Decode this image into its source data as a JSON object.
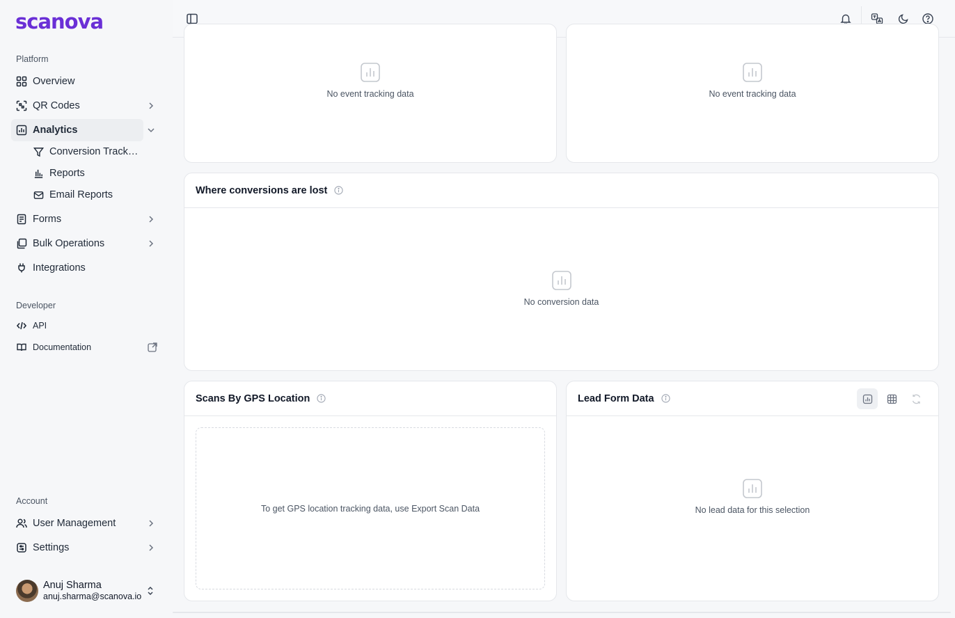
{
  "brand": {
    "logo_text": "scanova",
    "accent": "#6a2fd6"
  },
  "sidebar": {
    "sections": {
      "platform": "Platform",
      "developer": "Developer",
      "account": "Account"
    },
    "platform_items": [
      {
        "label": "Overview",
        "icon": "grid-icon"
      },
      {
        "label": "QR Codes",
        "icon": "qr-scan-icon"
      },
      {
        "label": "Analytics",
        "icon": "analytics-icon",
        "active": true,
        "expanded": true
      },
      {
        "label": "Forms",
        "icon": "form-icon"
      },
      {
        "label": "Bulk Operations",
        "icon": "bulk-icon"
      },
      {
        "label": "Integrations",
        "icon": "plug-icon"
      }
    ],
    "analytics_sub": [
      {
        "label": "Conversion Tracking",
        "icon": "funnel-icon"
      },
      {
        "label": "Reports",
        "icon": "bar-chart-icon"
      },
      {
        "label": "Email Reports",
        "icon": "mail-icon"
      }
    ],
    "developer_items": [
      {
        "label": "API",
        "icon": "code-icon"
      },
      {
        "label": "Documentation",
        "icon": "book-icon",
        "external": true
      }
    ],
    "account_items": [
      {
        "label": "User Management",
        "icon": "users-icon"
      },
      {
        "label": "Settings",
        "icon": "settings-icon"
      }
    ],
    "user": {
      "name": "Anuj Sharma",
      "email": "anuj.sharma@scanova.io"
    }
  },
  "topbar": {
    "icons": [
      "sidebar-toggle-icon",
      "bell-icon",
      "language-icon",
      "moon-icon",
      "help-icon"
    ]
  },
  "cards": {
    "top_left": {
      "message": "No event tracking data"
    },
    "top_right": {
      "message": "No event tracking data"
    },
    "conversions": {
      "title": "Where conversions are lost",
      "message": "No conversion data"
    },
    "gps": {
      "title": "Scans By GPS Location",
      "message": "To get GPS location tracking data, use Export Scan Data"
    },
    "lead": {
      "title": "Lead Form Data",
      "message": "No lead data for this selection",
      "views": [
        "chart-view-icon",
        "table-view-icon",
        "refresh-icon"
      ]
    }
  }
}
